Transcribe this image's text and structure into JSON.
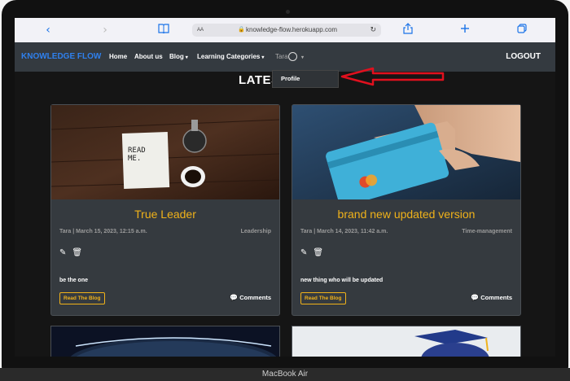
{
  "device": {
    "label": "MacBook Air"
  },
  "safari": {
    "url_prefix": "AA",
    "lock": "🔒",
    "url": "knowledge-flow.herokuapp.com",
    "back": "‹",
    "forward": "›",
    "reload": "↻"
  },
  "nav": {
    "brand": "KNOWLEDGE FLOW",
    "home": "Home",
    "about": "About us",
    "blog": "Blog",
    "categories": "Learning Categories",
    "user": "Tara",
    "logout": "LOGOUT",
    "caret": "▾"
  },
  "dropdown": {
    "profile": "Profile"
  },
  "heading": "LATES",
  "cards": [
    {
      "title": "True Leader",
      "meta": "Tara | March 15, 2023, 12:15 a.m.",
      "category": "Leadership",
      "excerpt": "be the one",
      "read_label": "Read The Blog",
      "comments_label": "Comments"
    },
    {
      "title": "brand new updated version",
      "meta": "Tara | March 14, 2023, 11:42 a.m.",
      "category": "Time-management",
      "excerpt": "new thing who will be updated",
      "read_label": "Read The Blog",
      "comments_label": "Comments"
    }
  ],
  "icons": {
    "edit": "✎",
    "delete": "🗑",
    "comment": "💬"
  },
  "colors": {
    "brand": "#2f80ed",
    "accent": "#f0b21a",
    "arrow": "#e0101e"
  }
}
